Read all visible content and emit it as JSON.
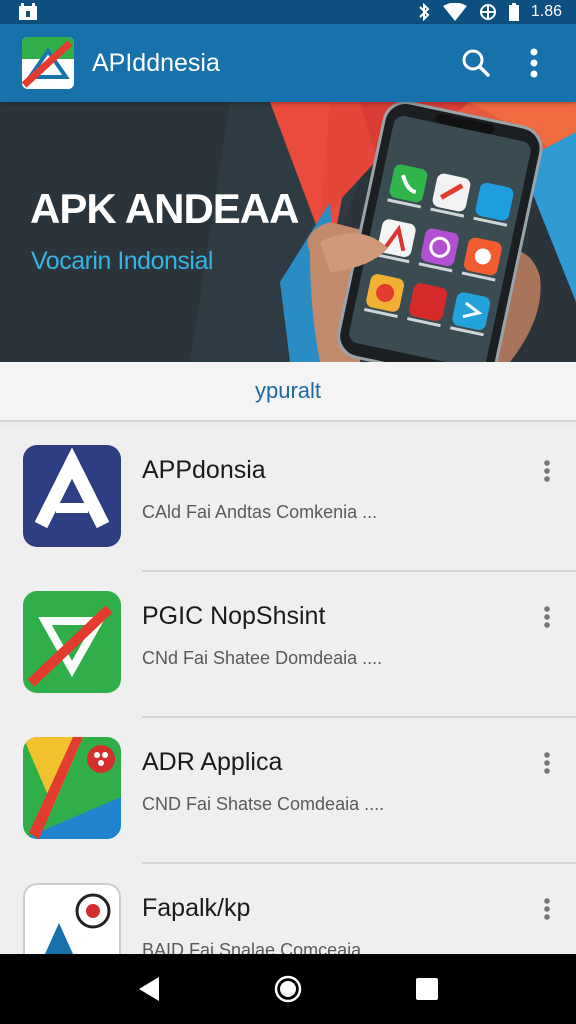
{
  "status_bar": {
    "time": "1.86"
  },
  "app_bar": {
    "title": "APIddnesia"
  },
  "banner": {
    "title": "APK ANDEAA",
    "subtitle": "Vocarin Indonsial"
  },
  "section": {
    "label": "ypuralt"
  },
  "apps": [
    {
      "name": "APPdonsia",
      "desc": "CAld Fai Andtas Comkenia ..."
    },
    {
      "name": "PGIC NopShsint",
      "desc": "CNd Fai Shatee Domdeaia ...."
    },
    {
      "name": "ADR Applica",
      "desc": "CND Fai Shatse Comdeaia ...."
    },
    {
      "name": "Fapalk/kp",
      "desc": "BAID Fai Snalae Comceaia ...."
    }
  ],
  "colors": {
    "app_bar": "#1772ab",
    "status_bar": "#0d4f80",
    "accent": "#35b3e3"
  }
}
